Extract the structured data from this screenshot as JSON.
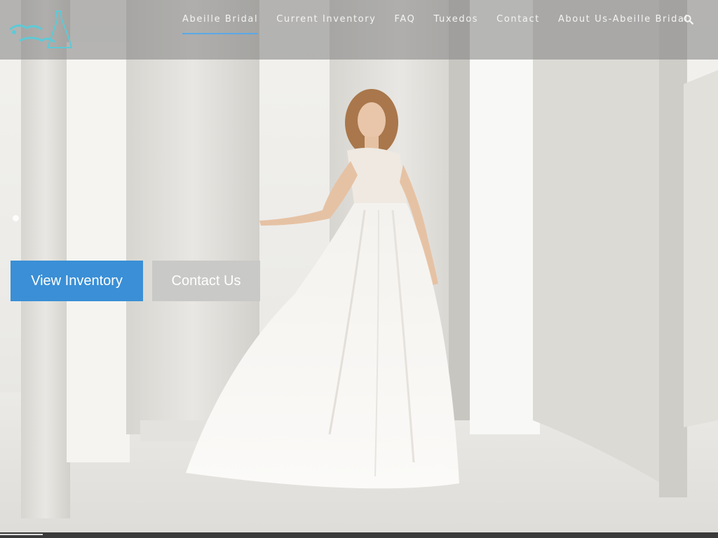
{
  "brand": {
    "logo_icon": "bridal-gown-logo-icon",
    "logo_color": "#5fc9d6"
  },
  "nav": {
    "items": [
      {
        "label": "Abeille Bridal",
        "active": true
      },
      {
        "label": "Current Inventory",
        "active": false
      },
      {
        "label": "FAQ",
        "active": false
      },
      {
        "label": "Tuxedos",
        "active": false
      },
      {
        "label": "Contact",
        "active": false
      },
      {
        "label": "About Us-Abeille Bridal",
        "active": false
      }
    ],
    "search_icon": "search-icon",
    "active_underline_color": "#5aa9e6"
  },
  "hero": {
    "image": "bride-in-white-lace-gown-photo",
    "buttons": {
      "primary": "View Inventory",
      "secondary": "Contact Us"
    },
    "primary_color": "#3a8fd6",
    "secondary_color": "#c9c9c7"
  },
  "slider": {
    "progress_fraction": 0.06
  }
}
